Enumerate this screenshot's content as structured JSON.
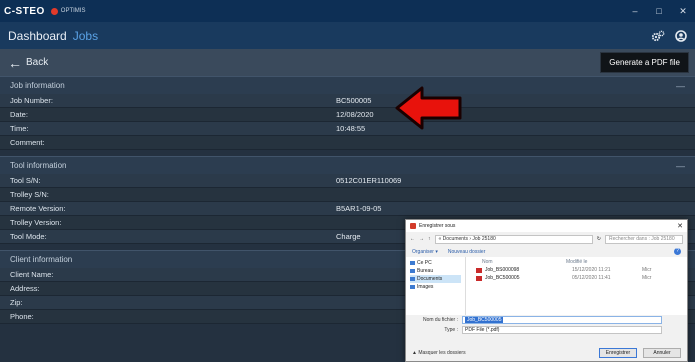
{
  "titlebar": {
    "logo": "C-STEO",
    "sub": "OPTIMIS",
    "controls": [
      "–",
      "□",
      "✕"
    ]
  },
  "nav": {
    "dashboard": "Dashboard",
    "jobs": "Jobs"
  },
  "back": {
    "label": "Back"
  },
  "pdf_button": "Generate a PDF file",
  "job_section": {
    "title": "Job information",
    "rows": [
      {
        "label": "Job Number:",
        "value": "BC500005"
      },
      {
        "label": "Date:",
        "value": "12/08/2020"
      },
      {
        "label": "Time:",
        "value": "10:48:55"
      },
      {
        "label": "Comment:",
        "value": ""
      }
    ]
  },
  "tool_section": {
    "title": "Tool information",
    "rows": [
      {
        "label": "Tool S/N:",
        "value": "0512C01ER110069"
      },
      {
        "label": "Trolley S/N:",
        "value": ""
      },
      {
        "label": "Remote Version:",
        "value": "B5AR1-09-05"
      },
      {
        "label": "Trolley Version:",
        "value": ""
      },
      {
        "label": "Tool Mode:",
        "value": "Charge"
      }
    ]
  },
  "client_section": {
    "title": "Client information",
    "rows": [
      {
        "label": "Client Name:",
        "value": ""
      },
      {
        "label": "Address:",
        "value": ""
      },
      {
        "label": "Zip:",
        "value": ""
      },
      {
        "label": "Phone:",
        "value": ""
      }
    ]
  },
  "dialog": {
    "title": "Enregistrer sous",
    "close": "✕",
    "path": "« Documents › Job 25180",
    "search_placeholder": "Rechercher dans : Job 25180",
    "organize": "Organiser ▾",
    "new_folder": "Nouveau dossier",
    "help": "?",
    "sidebar": [
      "Ce PC",
      "Bureau",
      "Documents",
      "Images"
    ],
    "columns": [
      "Nom",
      "Modifié le"
    ],
    "files": [
      {
        "name": "Job_BS000098",
        "date": "15/12/2020 11:21",
        "type": "Micr"
      },
      {
        "name": "Job_BC500005",
        "date": "05/12/2020 11:41",
        "type": "Micr"
      }
    ],
    "filename_label": "Nom du fichier :",
    "filename_value": "Job_BC500005",
    "type_label": "Type :",
    "type_value": "PDF File (*.pdf)",
    "hide_folders": "▲ Masquer les dossiers",
    "save": "Enregistrer",
    "cancel": "Annuler"
  }
}
